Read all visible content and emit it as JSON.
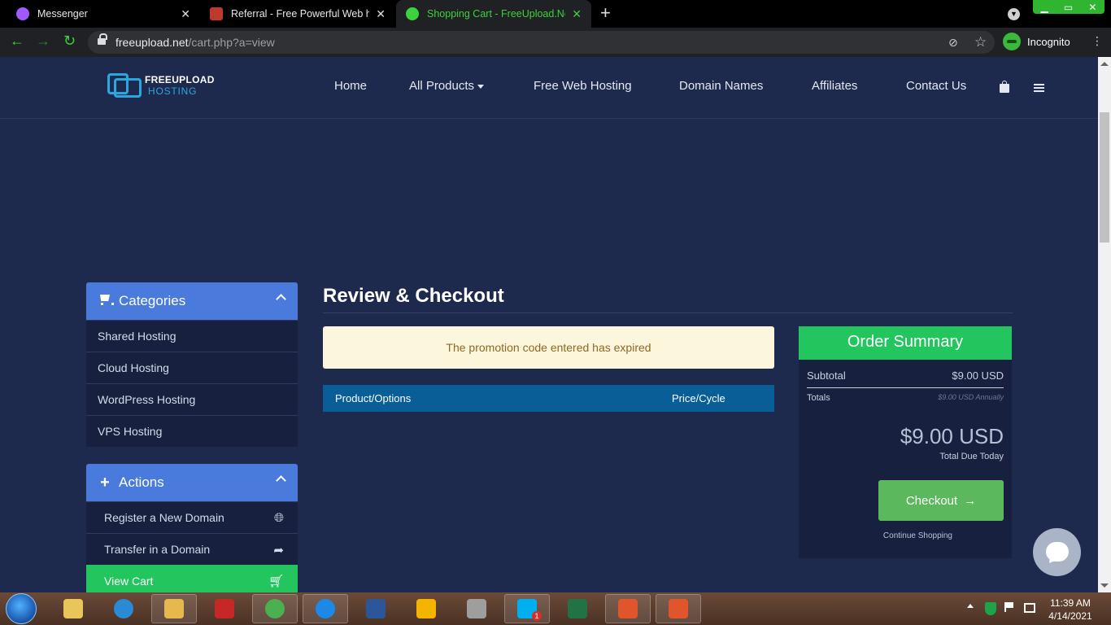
{
  "browser": {
    "tabs": [
      {
        "title": "Messenger",
        "color": "#a259ff"
      },
      {
        "title": "Referral - Free Powerful Web hos",
        "color": "#c0392b"
      },
      {
        "title": "Shopping Cart - FreeUpload.Net",
        "color": "#3dd13d"
      }
    ],
    "new_tab_symbol": "+",
    "url_domain": "freeupload.net",
    "url_path": "/cart.php?a=view",
    "profile_label": "Incognito",
    "win_controls": {
      "minimize": "▁",
      "restore": "▭",
      "close": "✕"
    }
  },
  "site": {
    "logo_line1": "FREEUPLOAD",
    "logo_line2": "HOSTING",
    "nav": {
      "home": "Home",
      "all_products": "All Products",
      "free_hosting": "Free Web Hosting",
      "domain_names": "Domain Names",
      "affiliates": "Affiliates",
      "contact_us": "Contact Us"
    }
  },
  "sidebar": {
    "categories": {
      "title": "Categories",
      "items": [
        "Shared Hosting",
        "Cloud Hosting",
        "WordPress Hosting",
        "VPS Hosting"
      ]
    },
    "actions": {
      "title": "Actions",
      "items": [
        {
          "label": "Register a New Domain",
          "icon": "globe-icon"
        },
        {
          "label": "Transfer in a Domain",
          "icon": "share-arrow-icon"
        },
        {
          "label": "View Cart",
          "icon": "cart-icon"
        }
      ]
    }
  },
  "main": {
    "title": "Review & Checkout",
    "alert": "The promotion code entered has expired",
    "table": {
      "col_product": "Product/Options",
      "col_price": "Price/Cycle"
    }
  },
  "summary": {
    "title": "Order Summary",
    "subtotal_label": "Subtotal",
    "subtotal_value": "$9.00 USD",
    "totals_label": "Totals",
    "totals_value": "$9.00 USD Annually",
    "total_due": "$9.00 USD",
    "total_due_label": "Total Due Today",
    "checkout_label": "Checkout",
    "continue_label": "Continue Shopping"
  },
  "taskbar": {
    "apps": [
      {
        "name": "files-app",
        "color": "#e8c65a"
      },
      {
        "name": "internet-explorer",
        "color": "#2a8ad4"
      },
      {
        "name": "file-explorer",
        "color": "#e6b84d"
      },
      {
        "name": "security-app",
        "color": "#c62828"
      },
      {
        "name": "chrome",
        "color": "#4caf50"
      },
      {
        "name": "edge",
        "color": "#1e88e5"
      },
      {
        "name": "word",
        "color": "#2b579a"
      },
      {
        "name": "paint-app",
        "color": "#f4b400"
      },
      {
        "name": "utility-app",
        "color": "#9e9e9e"
      },
      {
        "name": "skype",
        "color": "#00aff0"
      },
      {
        "name": "excel",
        "color": "#217346"
      },
      {
        "name": "fox-app-1",
        "color": "#e0552b"
      },
      {
        "name": "fox-app-2",
        "color": "#e0552b"
      }
    ],
    "skype_badge": "1",
    "time": "11:39 AM",
    "date": "4/14/2021"
  }
}
